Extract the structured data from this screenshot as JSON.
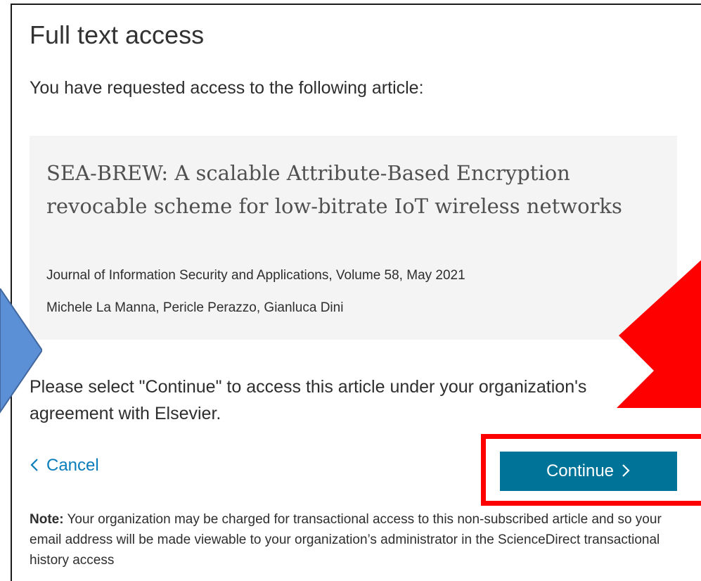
{
  "page": {
    "title": "Full text access",
    "intro": "You have requested access to the following article:"
  },
  "article": {
    "title": "SEA-BREW: A scalable Attribute-Based Encryption revocable scheme for low-bitrate IoT wireless networks",
    "journal": "Journal of Information Security and Applications, Volume 58, May 2021",
    "authors": "Michele La Manna, Pericle Perazzo, Gianluca Dini"
  },
  "instruction": "Please select \"Continue\" to access this article under your organization's agreement with Elsevier.",
  "actions": {
    "cancel_label": "Cancel",
    "continue_label": "Continue"
  },
  "note": {
    "label": "Note:",
    "text": " Your organization may be charged for transactional access to this non-subscribed article and so your email address will be made viewable to your organization’s administrator in the ScienceDirect transactional history access"
  },
  "icons": {
    "cancel": "chevron-left-icon",
    "continue": "chevron-right-icon",
    "annotation_arrow": "red-arrow-icon",
    "side_arrow": "blue-arrow-icon"
  },
  "colors": {
    "primary_button": "#007398",
    "link": "#0c7dbb",
    "card_background": "#f4f4f4",
    "annotation_red": "#ff0000",
    "annotation_blue": "#5b8fd6"
  }
}
